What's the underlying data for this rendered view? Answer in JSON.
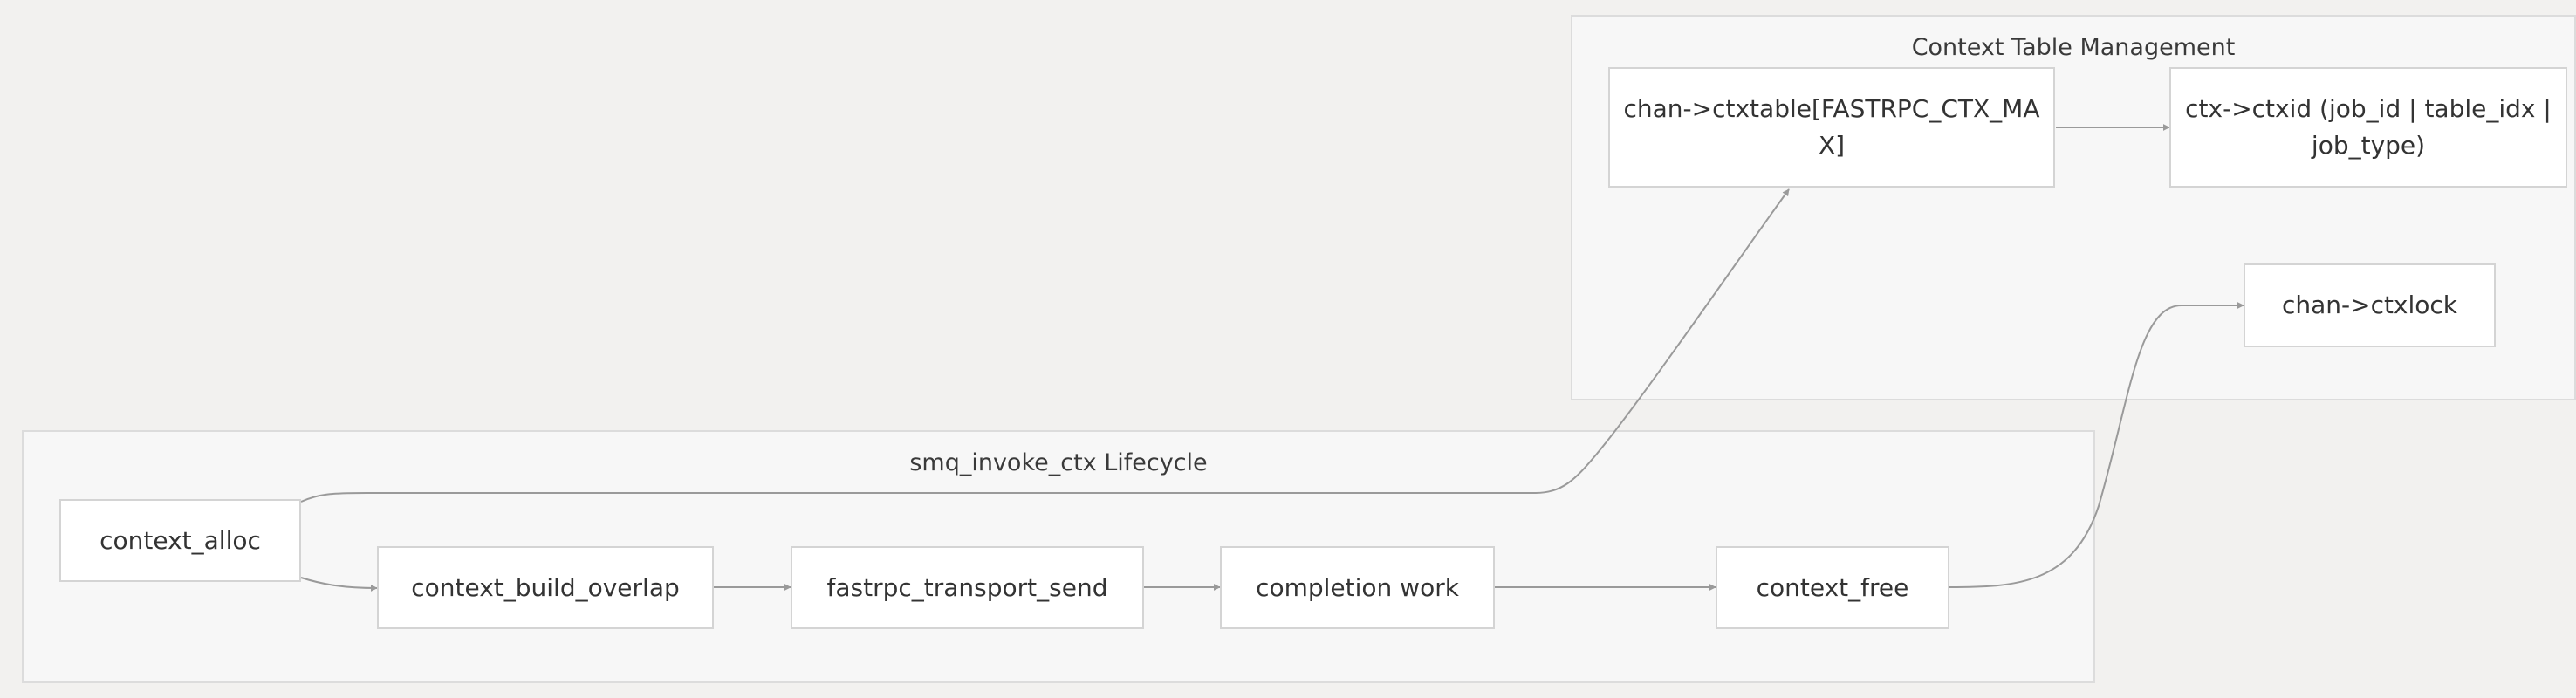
{
  "clusters": {
    "context_table": {
      "title": "Context Table Management"
    },
    "lifecycle": {
      "title": "smq_invoke_ctx Lifecycle"
    }
  },
  "nodes": {
    "ctxtable": "chan->ctxtable[FASTRPC_CTX_MAX]",
    "ctxid": "ctx->ctxid (job_id | table_idx | job_type)",
    "ctxlock": "chan->ctxlock",
    "context_alloc": "context_alloc",
    "context_build_overlap": "context_build_overlap",
    "fastrpc_transport_send": "fastrpc_transport_send",
    "completion_work": "completion work",
    "context_free": "context_free"
  },
  "colors": {
    "background": "#f2f1ef",
    "cluster_fill": "#f7f7f7",
    "node_fill": "#ffffff",
    "edge": "#9a9a9a"
  }
}
